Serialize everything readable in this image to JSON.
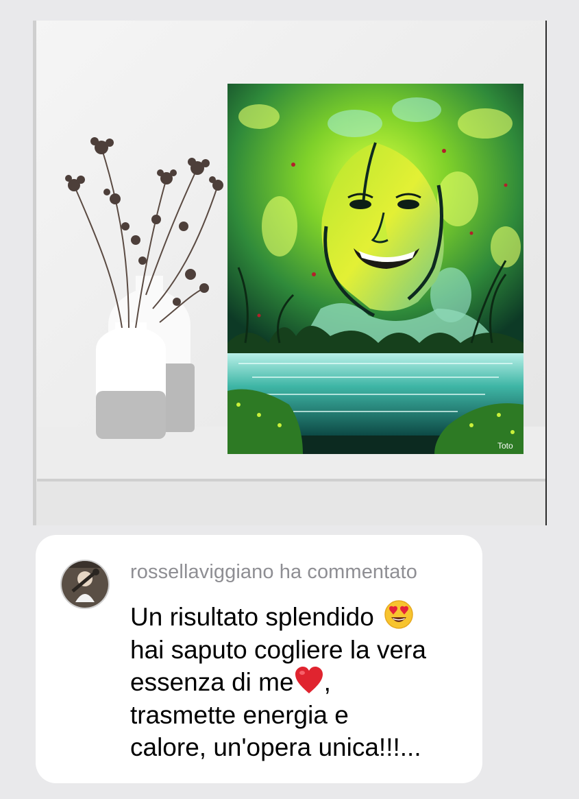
{
  "comment": {
    "author": "rossellaviggiano",
    "action": "ha commentato",
    "lines": [
      "Un risultato splendido",
      "hai saputo cogliere la vera",
      "essenza di me",
      ",",
      "trasmette energia e",
      "calore, un'opera unica!!!..."
    ]
  },
  "painting": {
    "signature": "Toto"
  },
  "icons": {
    "avatar": "user-avatar-photo",
    "emoji_1": "heart-eyes-emoji",
    "emoji_2": "red-heart-emoji"
  },
  "colors": {
    "background": "#e9e9eb",
    "bubble": "#ffffff",
    "header_text": "#8e8e93",
    "body_text": "#000000",
    "heart": "#e0242f"
  }
}
